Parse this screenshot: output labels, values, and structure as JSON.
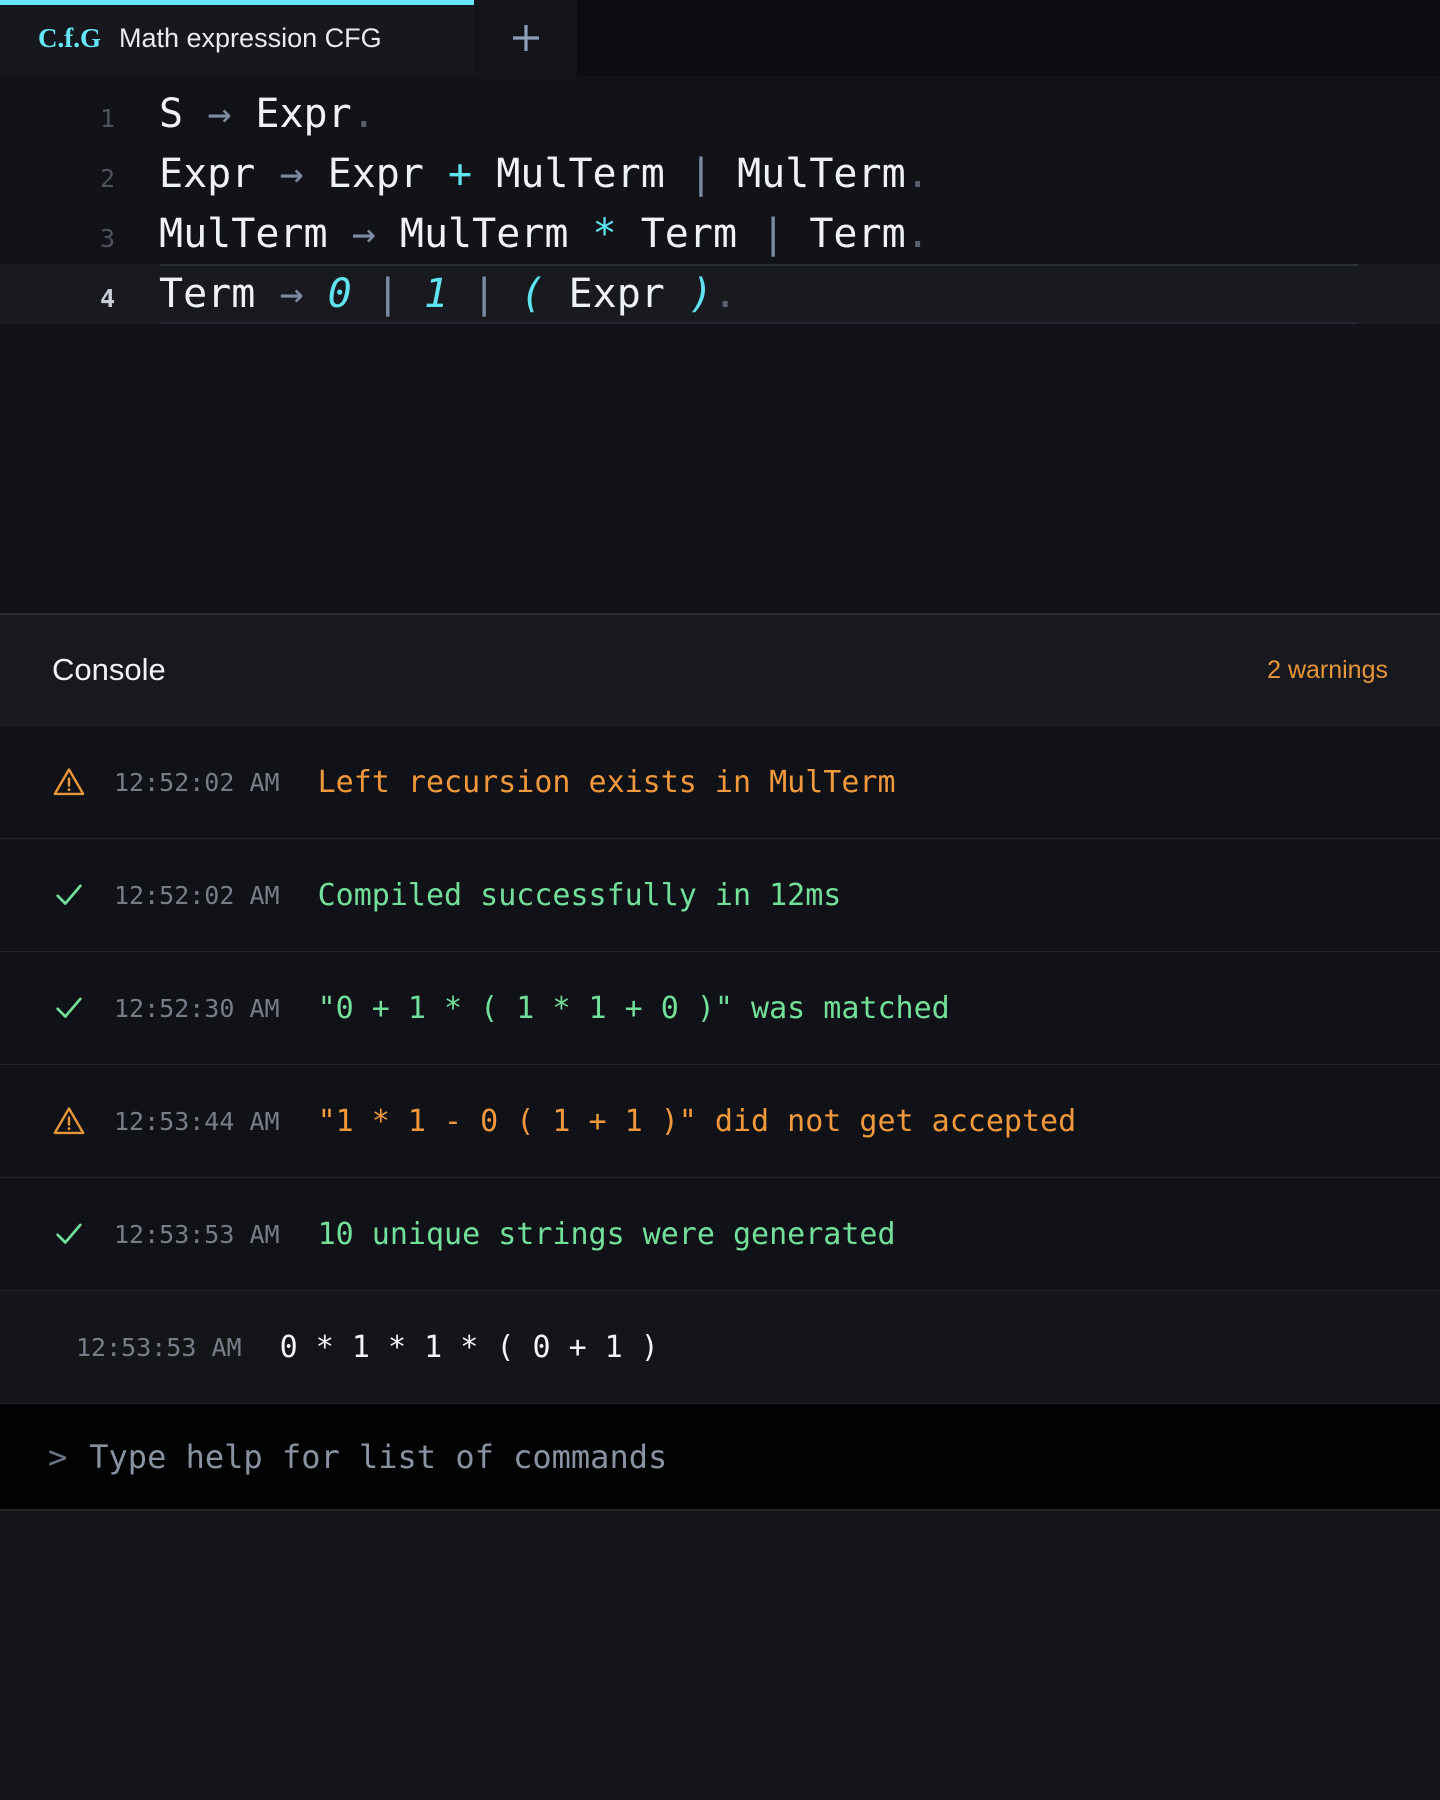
{
  "tabbar": {
    "tabs": [
      {
        "logo": "C.f.G",
        "title": "Math expression CFG",
        "active": true
      }
    ],
    "new_tab_label": "+",
    "new_tab_icon": "plus-icon",
    "accent_color": "#67e8f9"
  },
  "editor": {
    "lines": [
      {
        "number": "1",
        "active": false,
        "tokens": [
          {
            "text": "S",
            "kind": "nt"
          },
          {
            "text": " ",
            "kind": "nt"
          },
          {
            "text": "→",
            "kind": "arrow"
          },
          {
            "text": " ",
            "kind": "nt"
          },
          {
            "text": "Expr",
            "kind": "nt"
          },
          {
            "text": ".",
            "kind": "dot"
          }
        ]
      },
      {
        "number": "2",
        "active": false,
        "tokens": [
          {
            "text": "Expr",
            "kind": "nt"
          },
          {
            "text": " ",
            "kind": "nt"
          },
          {
            "text": "→",
            "kind": "arrow"
          },
          {
            "text": " ",
            "kind": "nt"
          },
          {
            "text": "Expr",
            "kind": "nt"
          },
          {
            "text": " ",
            "kind": "nt"
          },
          {
            "text": "+",
            "kind": "op"
          },
          {
            "text": " ",
            "kind": "nt"
          },
          {
            "text": "MulTerm",
            "kind": "nt"
          },
          {
            "text": " ",
            "kind": "nt"
          },
          {
            "text": "|",
            "kind": "pipe"
          },
          {
            "text": " ",
            "kind": "nt"
          },
          {
            "text": "MulTerm",
            "kind": "nt"
          },
          {
            "text": ".",
            "kind": "dot"
          }
        ]
      },
      {
        "number": "3",
        "active": false,
        "tokens": [
          {
            "text": "MulTerm",
            "kind": "nt"
          },
          {
            "text": " ",
            "kind": "nt"
          },
          {
            "text": "→",
            "kind": "arrow"
          },
          {
            "text": " ",
            "kind": "nt"
          },
          {
            "text": "MulTerm",
            "kind": "nt"
          },
          {
            "text": " ",
            "kind": "nt"
          },
          {
            "text": "*",
            "kind": "op"
          },
          {
            "text": " ",
            "kind": "nt"
          },
          {
            "text": "Term",
            "kind": "nt"
          },
          {
            "text": " ",
            "kind": "nt"
          },
          {
            "text": "|",
            "kind": "pipe"
          },
          {
            "text": " ",
            "kind": "nt"
          },
          {
            "text": "Term",
            "kind": "nt"
          },
          {
            "text": ".",
            "kind": "dot"
          }
        ]
      },
      {
        "number": "4",
        "active": true,
        "tokens": [
          {
            "text": "Term",
            "kind": "nt"
          },
          {
            "text": " ",
            "kind": "nt"
          },
          {
            "text": "→",
            "kind": "arrow"
          },
          {
            "text": " ",
            "kind": "nt"
          },
          {
            "text": "0",
            "kind": "term"
          },
          {
            "text": " ",
            "kind": "nt"
          },
          {
            "text": "|",
            "kind": "pipe"
          },
          {
            "text": " ",
            "kind": "nt"
          },
          {
            "text": "1",
            "kind": "term"
          },
          {
            "text": " ",
            "kind": "nt"
          },
          {
            "text": "|",
            "kind": "pipe"
          },
          {
            "text": " ",
            "kind": "nt"
          },
          {
            "text": "(",
            "kind": "term"
          },
          {
            "text": " ",
            "kind": "nt"
          },
          {
            "text": "Expr",
            "kind": "nt"
          },
          {
            "text": " ",
            "kind": "nt"
          },
          {
            "text": ")",
            "kind": "term"
          },
          {
            "text": ".",
            "kind": "dot"
          }
        ]
      }
    ]
  },
  "console": {
    "title": "Console",
    "warnings_label": "2 warnings",
    "warning_color": "#e8963a",
    "success_color": "#72e09a",
    "logs": [
      {
        "icon": "warning-triangle-icon",
        "level": "warn",
        "time": "12:52:02 AM",
        "message": "Left recursion exists in MulTerm"
      },
      {
        "icon": "check-icon",
        "level": "ok",
        "time": "12:52:02 AM",
        "message": "Compiled successfully in 12ms"
      },
      {
        "icon": "check-icon",
        "level": "ok",
        "time": "12:52:30 AM",
        "message": "\"0 + 1 * ( 1 * 1 + 0 )\" was matched"
      },
      {
        "icon": "warning-triangle-icon",
        "level": "warn",
        "time": "12:53:44 AM",
        "message": "\"1 * 1 - 0 ( 1 + 1 )\" did not get accepted"
      },
      {
        "icon": "check-icon",
        "level": "ok",
        "time": "12:53:53 AM",
        "message": "10 unique strings were generated"
      },
      {
        "icon": "none",
        "level": "plain",
        "time": "12:53:53 AM",
        "message": "0 * 1 * 1 * ( 0 + 1 )"
      }
    ]
  },
  "prompt": {
    "chevron": ">",
    "value": "",
    "placeholder": "Type help for list of commands"
  }
}
